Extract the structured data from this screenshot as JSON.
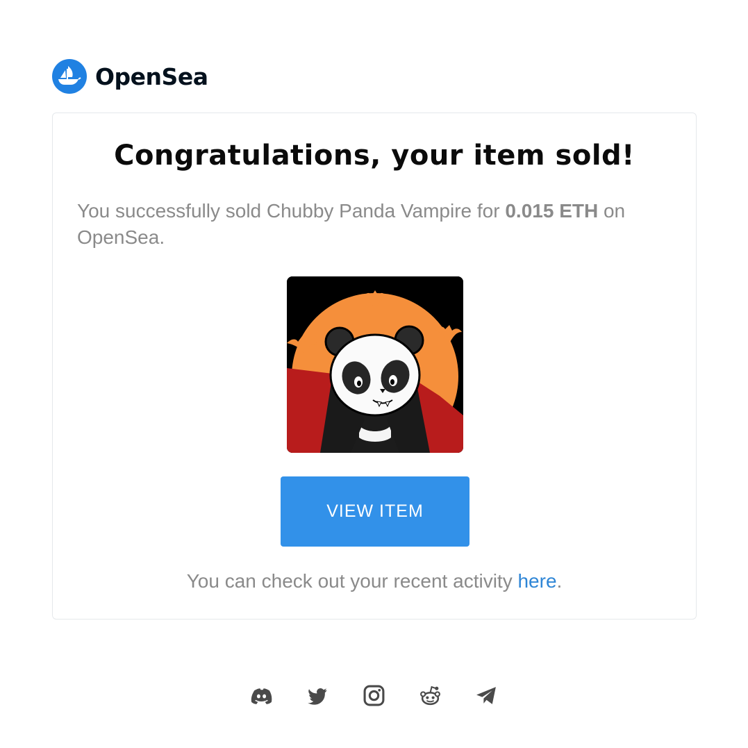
{
  "brand": {
    "name": "OpenSea",
    "logo_icon": "opensea-ship-icon",
    "color": "#2081e2"
  },
  "card": {
    "title": "Congratulations, your item sold!",
    "message_prefix": "You successfully sold Chubby Panda Vampire for ",
    "price": "0.015 ETH",
    "message_suffix": " on OpenSea.",
    "item_image": "chubby-panda-vampire-image",
    "button_label": "VIEW ITEM",
    "activity_prefix": "You can check out your recent activity ",
    "activity_link": "here",
    "activity_suffix": "."
  },
  "social_links": [
    {
      "icon": "discord-icon"
    },
    {
      "icon": "twitter-icon"
    },
    {
      "icon": "instagram-icon"
    },
    {
      "icon": "reddit-icon"
    },
    {
      "icon": "telegram-icon"
    }
  ],
  "colors": {
    "accent_button": "#3291e9",
    "link": "#2f86d6",
    "muted_text": "#8a8a8a"
  }
}
